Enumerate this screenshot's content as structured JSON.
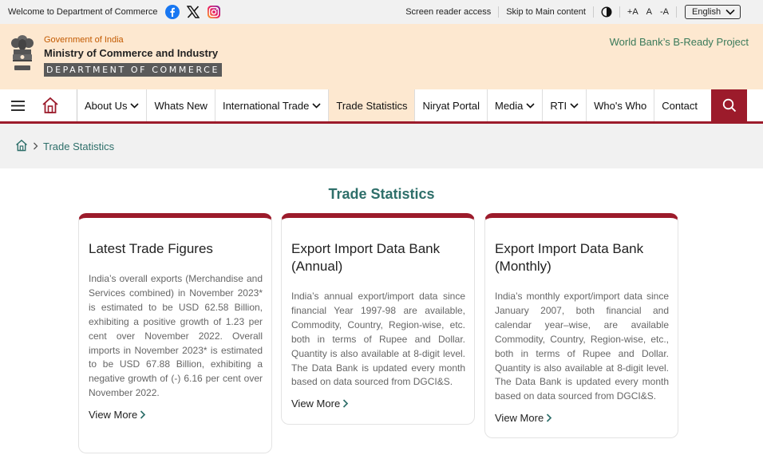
{
  "topbar": {
    "welcome": "Welcome to Department of Commerce",
    "screen_reader": "Screen reader access",
    "skip": "Skip to Main content",
    "font_increase": "+A",
    "font_normal": "A",
    "font_decrease": "-A",
    "language": "English"
  },
  "header": {
    "government": "Government of India",
    "ministry": "Ministry of Commerce and Industry",
    "department": "DEPARTMENT OF COMMERCE",
    "project_link": "World Bank’s B-Ready Project"
  },
  "nav": {
    "items": [
      {
        "label": "About Us"
      },
      {
        "label": "Whats New"
      },
      {
        "label": "International Trade"
      },
      {
        "label": "Trade Statistics"
      },
      {
        "label": "Niryat Portal"
      },
      {
        "label": "Media"
      },
      {
        "label": "RTI"
      },
      {
        "label": "Who's Who"
      },
      {
        "label": "Contact"
      }
    ]
  },
  "breadcrumb": {
    "current": "Trade Statistics"
  },
  "page_title": "Trade Statistics",
  "cards": [
    {
      "title": "Latest Trade Figures",
      "body": "India’s overall exports (Merchandise and Services combined) in November 2023* is estimated to be USD 62.58 Billion, exhibiting a positive growth of 1.23 per cent over November 2022. Overall imports in November 2023* is estimated to be USD 67.88 Billion, exhibiting a negative growth of (-) 6.16 per cent over November 2022.",
      "more": "View More"
    },
    {
      "title": "Export Import Data Bank (Annual)",
      "body": "India’s annual export/import data since financial Year 1997-98 are available, Commodity, Country, Region-wise, etc. both in terms of Rupee and Dollar. Quantity is also available at 8-digit level. The Data Bank is updated every month based on data sourced from DGCI&S.",
      "more": "View More"
    },
    {
      "title": "Export Import Data Bank (Monthly)",
      "body": "India’s monthly export/import data since January 2007, both financial and calendar year–wise, are available Commodity, Country, Region-wise, etc., both in terms of Rupee and Dollar. Quantity is also available at 8-digit level. The Data Bank is updated every month based on data sourced from DGCI&S.",
      "more": "View More"
    }
  ]
}
